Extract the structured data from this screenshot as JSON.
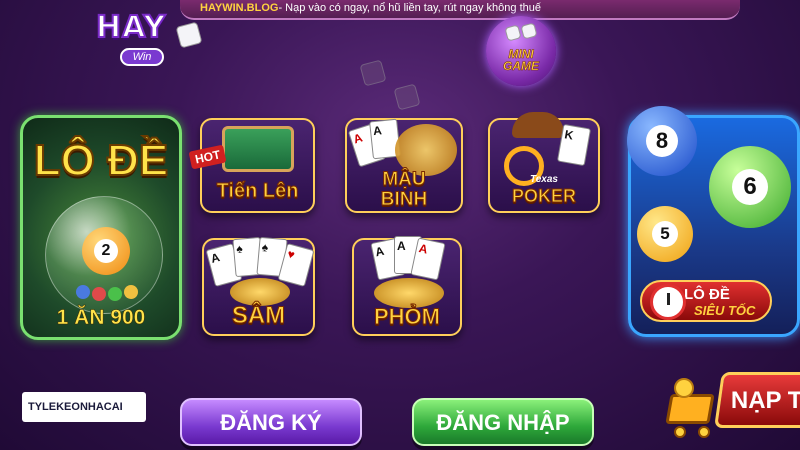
{
  "topbar": {
    "site": "HAYWIN.BLOG",
    "message": "- Nạp vào có ngay, nổ hũ liền tay, rút ngay không thuế"
  },
  "logo": {
    "word": "HAY",
    "sub": "Win"
  },
  "minigame": {
    "label_line1": "MINI",
    "label_line2": "GAME"
  },
  "games": {
    "lode": {
      "title": "LÔ ĐỀ",
      "ball_number": "2",
      "odds": "1 ĂN 900"
    },
    "tienlen": {
      "badge": "HOT",
      "label": "Tiến Lên"
    },
    "maubinh": {
      "label_line1": "MẬU",
      "label_line2": "BINH"
    },
    "poker": {
      "small": "Texas",
      "label": "POKER"
    },
    "sam": {
      "label": "SÂM"
    },
    "phom": {
      "label": "PHỎM"
    },
    "sieutoc": {
      "ball_a": "8",
      "ball_b": "6",
      "ball_c": "5",
      "label_line1": "LÔ ĐỀ",
      "label_line2": "SIÊU TỐC"
    }
  },
  "buttons": {
    "register": "ĐĂNG KÝ",
    "login": "ĐĂNG NHẬP",
    "deposit": "NẠP T"
  },
  "ad": {
    "text": "TYLEKEONHACAI"
  },
  "colors": {
    "gold": "#ffd23f",
    "purple": "#7a3ad0",
    "green": "#2ea83a",
    "red": "#e03030",
    "blue": "#1a6ae0"
  }
}
